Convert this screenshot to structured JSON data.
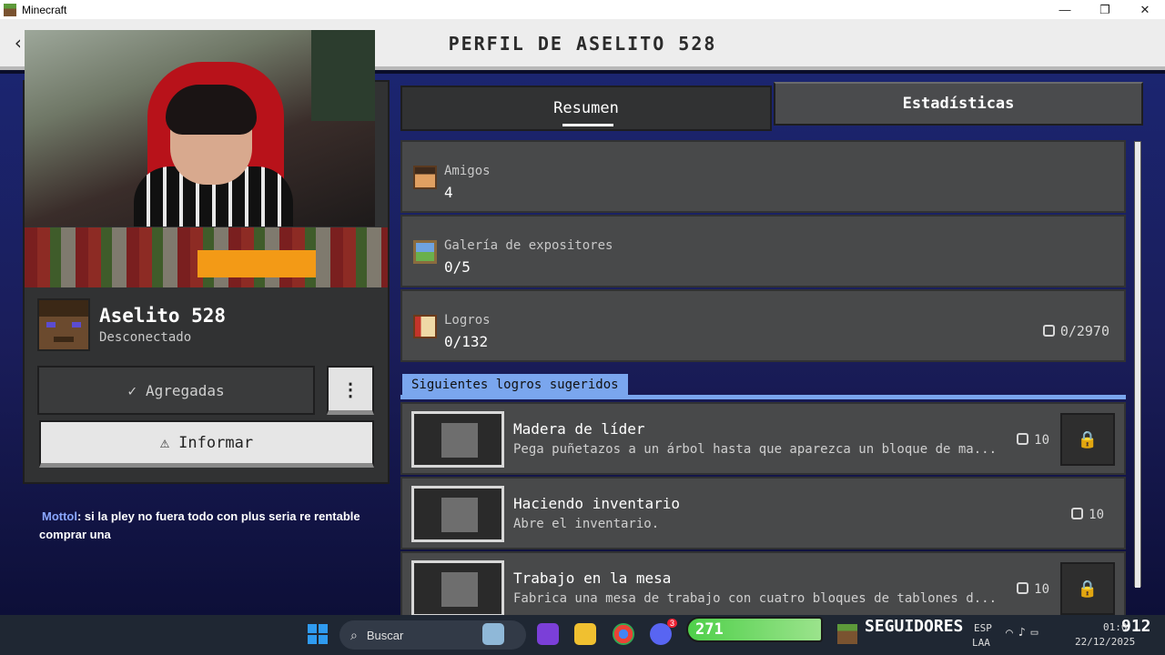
{
  "window": {
    "title": "Minecraft",
    "controls": [
      "—",
      "❐",
      "✕"
    ]
  },
  "header": {
    "title": "PERFIL DE ASELITO 528",
    "back_icon": "back-arrow-icon"
  },
  "profile": {
    "name": "Aselito 528",
    "status": "Desconectado",
    "added_label": "Agregadas",
    "more_label": "⋮",
    "report_label": "Informar"
  },
  "chat": {
    "user": "Mottol",
    "message": ": si la pley no fuera todo con plus seria re rentable comprar una"
  },
  "tabs": [
    {
      "label": "Resumen",
      "active": true
    },
    {
      "label": "Estadísticas",
      "active": false
    }
  ],
  "stats": [
    {
      "label": "Amigos",
      "value": "4",
      "icon": "friends-icon"
    },
    {
      "label": "Galería de expositores",
      "value": "0/5",
      "icon": "gallery-icon"
    },
    {
      "label": "Logros",
      "value": "0/132",
      "icon": "achievements-book-icon",
      "score": "0/2970"
    }
  ],
  "suggested": {
    "label": "Siguientes logros sugeridos",
    "items": [
      {
        "title": "Madera de líder",
        "description": "Pega puñetazos a un árbol hasta que aparezca un bloque de ma...",
        "points": "10",
        "locked": true
      },
      {
        "title": "Haciendo inventario",
        "description": "Abre el inventario.",
        "points": "10",
        "locked": false
      },
      {
        "title": "Trabajo en la mesa",
        "description": "Fabrica una mesa de trabajo con cuatro bloques de tablones d...",
        "points": "10",
        "locked": true
      }
    ]
  },
  "taskbar": {
    "search_placeholder": "Buscar",
    "discord_badge": "3"
  },
  "follower_widget": {
    "count": "271",
    "label": "SEGUIDORES",
    "total": "912"
  },
  "tray": {
    "lang_top": "ESP",
    "lang_bottom": "LAA",
    "time": "01:0",
    "date": "22/12/2025"
  },
  "colors": {
    "panel": "#313233",
    "card": "#48494a",
    "accent_blue": "#7aa6ee",
    "header_bg": "#ededed"
  }
}
